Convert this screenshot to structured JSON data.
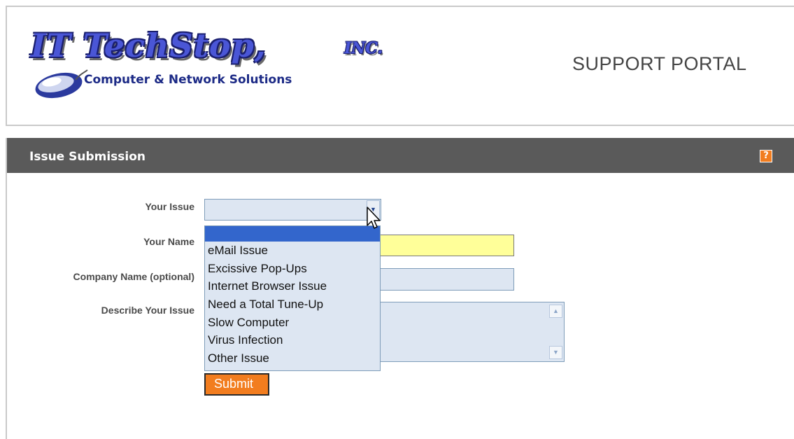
{
  "header": {
    "logo": {
      "title": "IT TechStop,",
      "inc": "INC.",
      "tagline": "Computer & Network Solutions"
    },
    "portal_title": "SUPPORT PORTAL"
  },
  "panel": {
    "title": "Issue Submission",
    "help_icon_glyph": "?"
  },
  "form": {
    "issue_label": "Your Issue",
    "name_label": "Your Name",
    "company_label": "Company Name (optional)",
    "describe_label": "Describe Your Issue",
    "issue_value": "",
    "name_value": "",
    "company_value": "",
    "describe_value": "",
    "issue_options": [
      "",
      "eMail Issue",
      "Excissive Pop-Ups",
      "Internet Browser Issue",
      "Need a Total Tune-Up",
      "Slow Computer",
      "Virus Infection",
      "Other Issue"
    ],
    "submit_label": "Submit"
  },
  "colors": {
    "accent_orange": "#f27d1f",
    "panel_bar": "#5a5a5a",
    "field_bg": "#dde6f2",
    "required_field_bg": "#ffff99",
    "selected_option_bg": "#3366cc",
    "logo_blue": "#4a56d6"
  },
  "icons": {
    "dropdown_arrow": "chevron-down-icon",
    "help": "help-icon",
    "cursor": "mouse-pointer-icon",
    "logo_mouse": "computer-mouse-icon"
  }
}
